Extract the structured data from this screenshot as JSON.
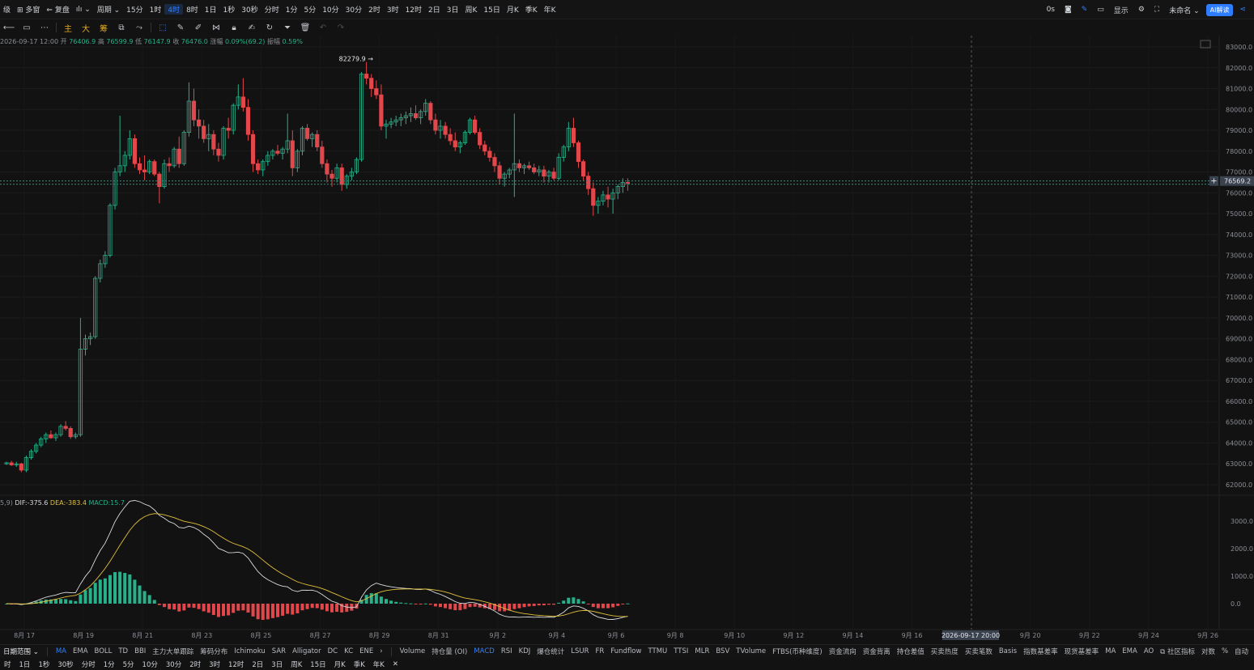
{
  "topbar": {
    "items": [
      "级",
      "⊞ 多窗",
      "⇐ 复盘",
      "ılı ⌄",
      "周期 ⌄",
      "15分",
      "1时",
      "4时",
      "8时",
      "1日",
      "1秒",
      "30秒",
      "分时",
      "1分",
      "5分",
      "10分",
      "30分",
      "2时",
      "3时",
      "12时",
      "2日",
      "3日",
      "周K",
      "15日",
      "月K",
      "季K",
      "年K"
    ],
    "active_index": 7,
    "right": {
      "count": "0s",
      "display": "显示",
      "unnamed": "未命名 ⌄",
      "ai": "AI解读"
    }
  },
  "toolbar": {
    "indicators": [
      "主",
      "大",
      "筹"
    ]
  },
  "ohlc": {
    "time": "2026-09-17 12:00",
    "open_label": "开",
    "open": "76406.9",
    "high_label": "高",
    "high": "76599.9",
    "low_label": "低",
    "low": "76147.9",
    "close_label": "收",
    "close": "76476.0",
    "change_label": "涨幅",
    "change": "0.09%(69.2)",
    "amp_label": "振幅",
    "amp": "0.59%"
  },
  "macd": {
    "params": "5,9)",
    "dif": "DIF:-375.6",
    "dea": "DEA:-383.4",
    "macd": "MACD:15.7"
  },
  "price_axis": [
    "83000.0",
    "82000.0",
    "81000.0",
    "80000.0",
    "79000.0",
    "78000.0",
    "77000.0",
    "76000.0",
    "75000.0",
    "74000.0",
    "73000.0",
    "72000.0",
    "71000.0",
    "70000.0",
    "69000.0",
    "68000.0",
    "67000.0",
    "66000.0",
    "65000.0",
    "64000.0",
    "63000.0",
    "62000.0"
  ],
  "macd_axis": [
    "3000.0",
    "2000.0",
    "1000.0",
    "0.0"
  ],
  "date_axis": [
    "8月 17",
    "8月 19",
    "8月 21",
    "8月 23",
    "8月 25",
    "8月 27",
    "8月 29",
    "8月 31",
    "9月 2",
    "9月 4",
    "9月 6",
    "9月 8",
    "9月 10",
    "9月 12",
    "9月 14",
    "9月 16",
    "9月 20",
    "9月 22",
    "9月 24",
    "9月 26"
  ],
  "crosshair": {
    "date": "2026-09-17 20:00",
    "price": "76569.2"
  },
  "max_label": "82279.9 →",
  "bottom_indicators": {
    "date_range": "日期范围 ⌄",
    "main": [
      "MA",
      "EMA",
      "BOLL",
      "TD",
      "BBI",
      "主力大单跟踪",
      "筹码分布",
      "Ichimoku",
      "SAR",
      "Alligator",
      "DC",
      "KC",
      "ENE",
      "›"
    ],
    "sub": [
      "Volume",
      "持仓量 (OI)",
      "MACD",
      "RSI",
      "KDJ",
      "爆仓统计",
      "LSUR",
      "FR",
      "Fundflow",
      "TTMU",
      "TTSI",
      "MLR",
      "BSV",
      "TVolume",
      "FTBS(币种维度)",
      "资金流向",
      "资金背离",
      "持仓差值",
      "买卖热度",
      "买卖笔数",
      "Basis",
      "指数基差率",
      "现货基差率",
      "MA",
      "EMA",
      "AO",
      "⧉ 社区指标",
      "对数",
      "%",
      "自动"
    ],
    "sub_active": "MACD"
  },
  "bottom_periods": [
    "时",
    "1日",
    "1秒",
    "30秒",
    "分时",
    "1分",
    "5分",
    "10分",
    "30分",
    "2时",
    "3时",
    "12时",
    "2日",
    "3日",
    "周K",
    "15日",
    "月K",
    "季K",
    "年K",
    "✕"
  ],
  "colors": {
    "up": "#27b08a",
    "down": "#e2474b",
    "accent": "#2f80ff",
    "dif": "#d9dbdf",
    "dea": "#e3c13a"
  },
  "chart_data": {
    "type": "candlestick",
    "y_range": [
      61500,
      83200
    ],
    "x_range_days": [
      "8月 16",
      "9月 27"
    ],
    "candles_4h": [
      [
        63000,
        63100,
        62950,
        63050
      ],
      [
        63050,
        63150,
        62900,
        62950
      ],
      [
        62950,
        63100,
        62850,
        63000
      ],
      [
        63000,
        63050,
        62600,
        62700
      ],
      [
        62700,
        63400,
        62600,
        63300
      ],
      [
        63300,
        63700,
        63200,
        63600
      ],
      [
        63600,
        64000,
        63500,
        63900
      ],
      [
        63900,
        64300,
        63800,
        64200
      ],
      [
        64200,
        64500,
        64000,
        64400
      ],
      [
        64400,
        64600,
        64200,
        64250
      ],
      [
        64250,
        64500,
        64100,
        64400
      ],
      [
        64400,
        64900,
        64300,
        64800
      ],
      [
        64800,
        65050,
        64600,
        64700
      ],
      [
        64700,
        64800,
        64200,
        64300
      ],
      [
        64300,
        64500,
        64200,
        64400
      ],
      [
        64400,
        70000,
        64300,
        68500
      ],
      [
        68500,
        69200,
        68200,
        69000
      ],
      [
        69000,
        69300,
        68700,
        69100
      ],
      [
        69100,
        72000,
        69000,
        71900
      ],
      [
        71900,
        72800,
        71700,
        72600
      ],
      [
        72600,
        73200,
        72400,
        73000
      ],
      [
        73000,
        75500,
        72900,
        75400
      ],
      [
        75400,
        77200,
        75200,
        77000
      ],
      [
        77000,
        79700,
        76800,
        77300
      ],
      [
        77300,
        78000,
        77000,
        77800
      ],
      [
        77800,
        79000,
        77600,
        78600
      ],
      [
        78600,
        78800,
        77200,
        77400
      ],
      [
        77400,
        77700,
        76900,
        77100
      ],
      [
        77100,
        77800,
        76600,
        77000
      ],
      [
        77000,
        77600,
        76900,
        77500
      ],
      [
        77500,
        77600,
        76800,
        76900
      ],
      [
        76900,
        77000,
        75500,
        76300
      ],
      [
        76300,
        77600,
        76200,
        77400
      ],
      [
        77400,
        77700,
        77000,
        77300
      ],
      [
        77300,
        78200,
        77200,
        78100
      ],
      [
        78100,
        78700,
        77200,
        77400
      ],
      [
        77400,
        79000,
        77300,
        78900
      ],
      [
        78900,
        81300,
        78700,
        80400
      ],
      [
        80400,
        81000,
        79200,
        79500
      ],
      [
        79500,
        80000,
        78600,
        79200
      ],
      [
        79200,
        79500,
        78400,
        78600
      ],
      [
        78600,
        79300,
        78000,
        78800
      ],
      [
        78800,
        79000,
        77800,
        78100
      ],
      [
        78100,
        78400,
        77500,
        77800
      ],
      [
        77800,
        79200,
        77600,
        79100
      ],
      [
        79100,
        79600,
        78600,
        79000
      ],
      [
        79000,
        80300,
        78800,
        80200
      ],
      [
        80200,
        81200,
        80000,
        80600
      ],
      [
        80600,
        81500,
        79900,
        80100
      ],
      [
        80100,
        80500,
        78500,
        78800
      ],
      [
        78800,
        79000,
        77000,
        77400
      ],
      [
        77400,
        77600,
        76900,
        77100
      ],
      [
        77100,
        77600,
        76800,
        77500
      ],
      [
        77500,
        78000,
        77300,
        77800
      ],
      [
        77800,
        78100,
        77600,
        78000
      ],
      [
        78000,
        78300,
        77800,
        77900
      ],
      [
        77900,
        78200,
        77600,
        78100
      ],
      [
        78100,
        79800,
        77900,
        78500
      ],
      [
        78500,
        79000,
        76800,
        77200
      ],
      [
        77200,
        78100,
        77000,
        78000
      ],
      [
        78000,
        79200,
        77800,
        79100
      ],
      [
        79100,
        79300,
        78500,
        78600
      ],
      [
        78600,
        78900,
        78200,
        78800
      ],
      [
        78800,
        79000,
        78000,
        78200
      ],
      [
        78200,
        78500,
        77200,
        77400
      ],
      [
        77400,
        77600,
        76500,
        76900
      ],
      [
        76900,
        77100,
        76300,
        76700
      ],
      [
        76700,
        77400,
        76500,
        77200
      ],
      [
        77200,
        77400,
        76100,
        76400
      ],
      [
        76400,
        76900,
        76200,
        76800
      ],
      [
        76800,
        77200,
        76600,
        77000
      ],
      [
        77000,
        77700,
        76900,
        77600
      ],
      [
        77600,
        81800,
        77500,
        81700
      ],
      [
        81700,
        82280,
        81200,
        81500
      ],
      [
        81500,
        81700,
        80600,
        81000
      ],
      [
        81000,
        81400,
        80500,
        80700
      ],
      [
        80700,
        81200,
        79000,
        79200
      ],
      [
        79200,
        79500,
        78600,
        79300
      ],
      [
        79300,
        79600,
        79100,
        79400
      ],
      [
        79400,
        79700,
        79200,
        79500
      ],
      [
        79500,
        79800,
        79200,
        79600
      ],
      [
        79600,
        79900,
        79300,
        79700
      ],
      [
        79700,
        80100,
        79400,
        79800
      ],
      [
        79800,
        80200,
        79500,
        79600
      ],
      [
        79600,
        80000,
        79300,
        79900
      ],
      [
        79900,
        80500,
        79700,
        80300
      ],
      [
        80300,
        80400,
        79300,
        79500
      ],
      [
        79500,
        79800,
        78800,
        79000
      ],
      [
        79000,
        79500,
        78600,
        79200
      ],
      [
        79200,
        79400,
        78600,
        78800
      ],
      [
        78800,
        79100,
        78300,
        78500
      ],
      [
        78500,
        78900,
        78000,
        78200
      ],
      [
        78200,
        78500,
        77900,
        78400
      ],
      [
        78400,
        79000,
        78300,
        78900
      ],
      [
        78900,
        79600,
        78800,
        79500
      ],
      [
        79500,
        79700,
        78800,
        78900
      ],
      [
        78900,
        79100,
        78100,
        78300
      ],
      [
        78300,
        78500,
        77800,
        78000
      ],
      [
        78000,
        78200,
        77500,
        77700
      ],
      [
        77700,
        77900,
        77000,
        77300
      ],
      [
        77300,
        77500,
        76400,
        76700
      ],
      [
        76700,
        77000,
        76300,
        76900
      ],
      [
        76900,
        77200,
        76700,
        77100
      ],
      [
        77100,
        79800,
        75800,
        77400
      ],
      [
        77400,
        77600,
        77000,
        77200
      ],
      [
        77200,
        77400,
        76900,
        77300
      ],
      [
        77300,
        77500,
        77100,
        77200
      ],
      [
        77200,
        77400,
        76900,
        77000
      ],
      [
        77000,
        77300,
        76800,
        77100
      ],
      [
        77100,
        77300,
        76500,
        76800
      ],
      [
        76800,
        77100,
        76500,
        77000
      ],
      [
        77000,
        77200,
        76600,
        76700
      ],
      [
        76700,
        77900,
        76600,
        77700
      ],
      [
        77700,
        78300,
        77500,
        78200
      ],
      [
        78200,
        79400,
        78000,
        79100
      ],
      [
        79100,
        79600,
        78200,
        78400
      ],
      [
        78400,
        78500,
        77200,
        77500
      ],
      [
        77500,
        77600,
        76600,
        76800
      ],
      [
        76800,
        77000,
        75900,
        76200
      ],
      [
        76200,
        76500,
        74900,
        75400
      ],
      [
        75400,
        75800,
        75000,
        75600
      ],
      [
        75600,
        76100,
        75400,
        75900
      ],
      [
        75900,
        76300,
        75300,
        75700
      ],
      [
        75700,
        76200,
        75000,
        76000
      ],
      [
        76000,
        76400,
        75700,
        76300
      ],
      [
        76300,
        76700,
        76000,
        76500
      ],
      [
        76500,
        76700,
        76100,
        76476
      ]
    ],
    "macd_range": [
      -1000,
      3500
    ]
  }
}
